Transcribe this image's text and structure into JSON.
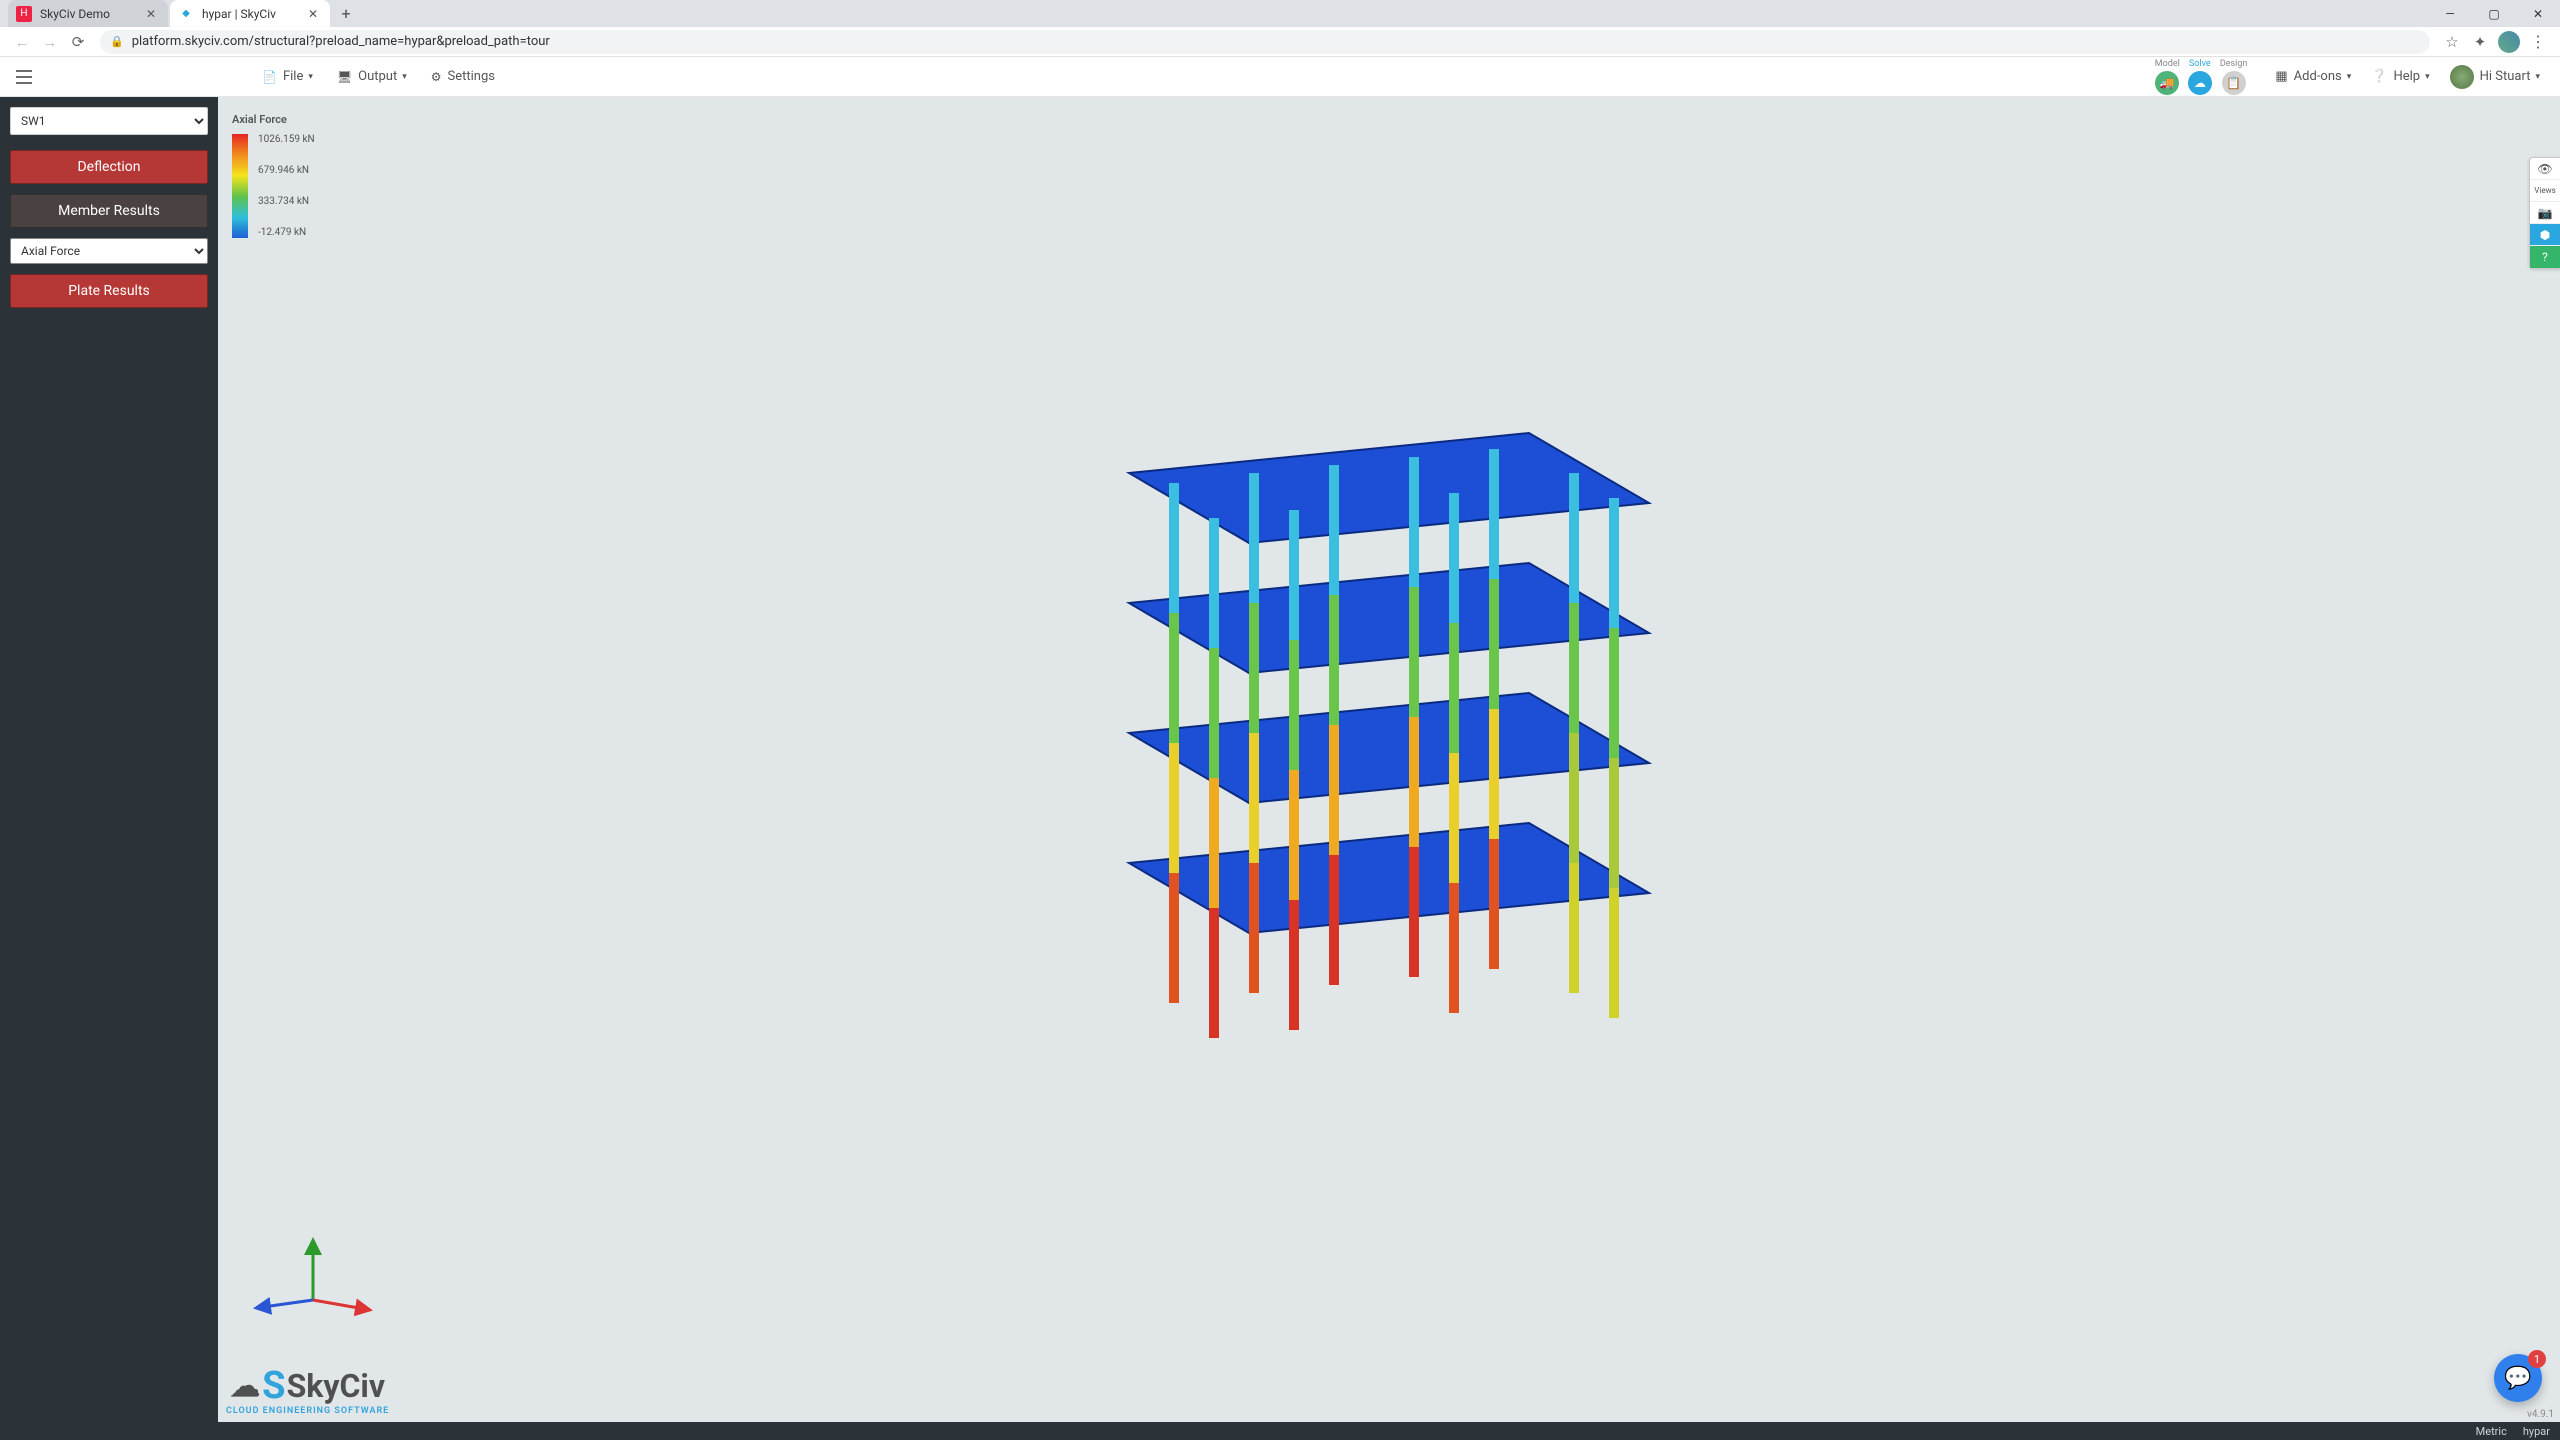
{
  "browser": {
    "tabs": [
      {
        "title": "SkyCiv Demo",
        "active": false
      },
      {
        "title": "hypar | SkyCiv",
        "active": true
      }
    ],
    "url": "platform.skyciv.com/structural?preload_name=hypar&preload_path=tour"
  },
  "toolbar": {
    "file": "File",
    "output": "Output",
    "settings": "Settings",
    "modes": {
      "model": "Model",
      "solve": "Solve",
      "design": "Design"
    },
    "addons": "Add-ons",
    "help": "Help",
    "user_greeting": "Hi Stuart"
  },
  "sidebar": {
    "load_case": "SW1",
    "deflection": "Deflection",
    "member_results": "Member Results",
    "result_type": "Axial Force",
    "plate_results": "Plate Results"
  },
  "legend": {
    "title": "Axial Force",
    "ticks": [
      "1026.159 kN",
      "679.946 kN",
      "333.734 kN",
      "-12.479 kN"
    ]
  },
  "logo": {
    "name": "SkyCiv",
    "sub": "CLOUD ENGINEERING SOFTWARE"
  },
  "side_tools": {
    "views_label": "Views"
  },
  "chat_badge": "1",
  "version": "v4.9.1",
  "status": {
    "units": "Metric",
    "project": "hypar"
  }
}
